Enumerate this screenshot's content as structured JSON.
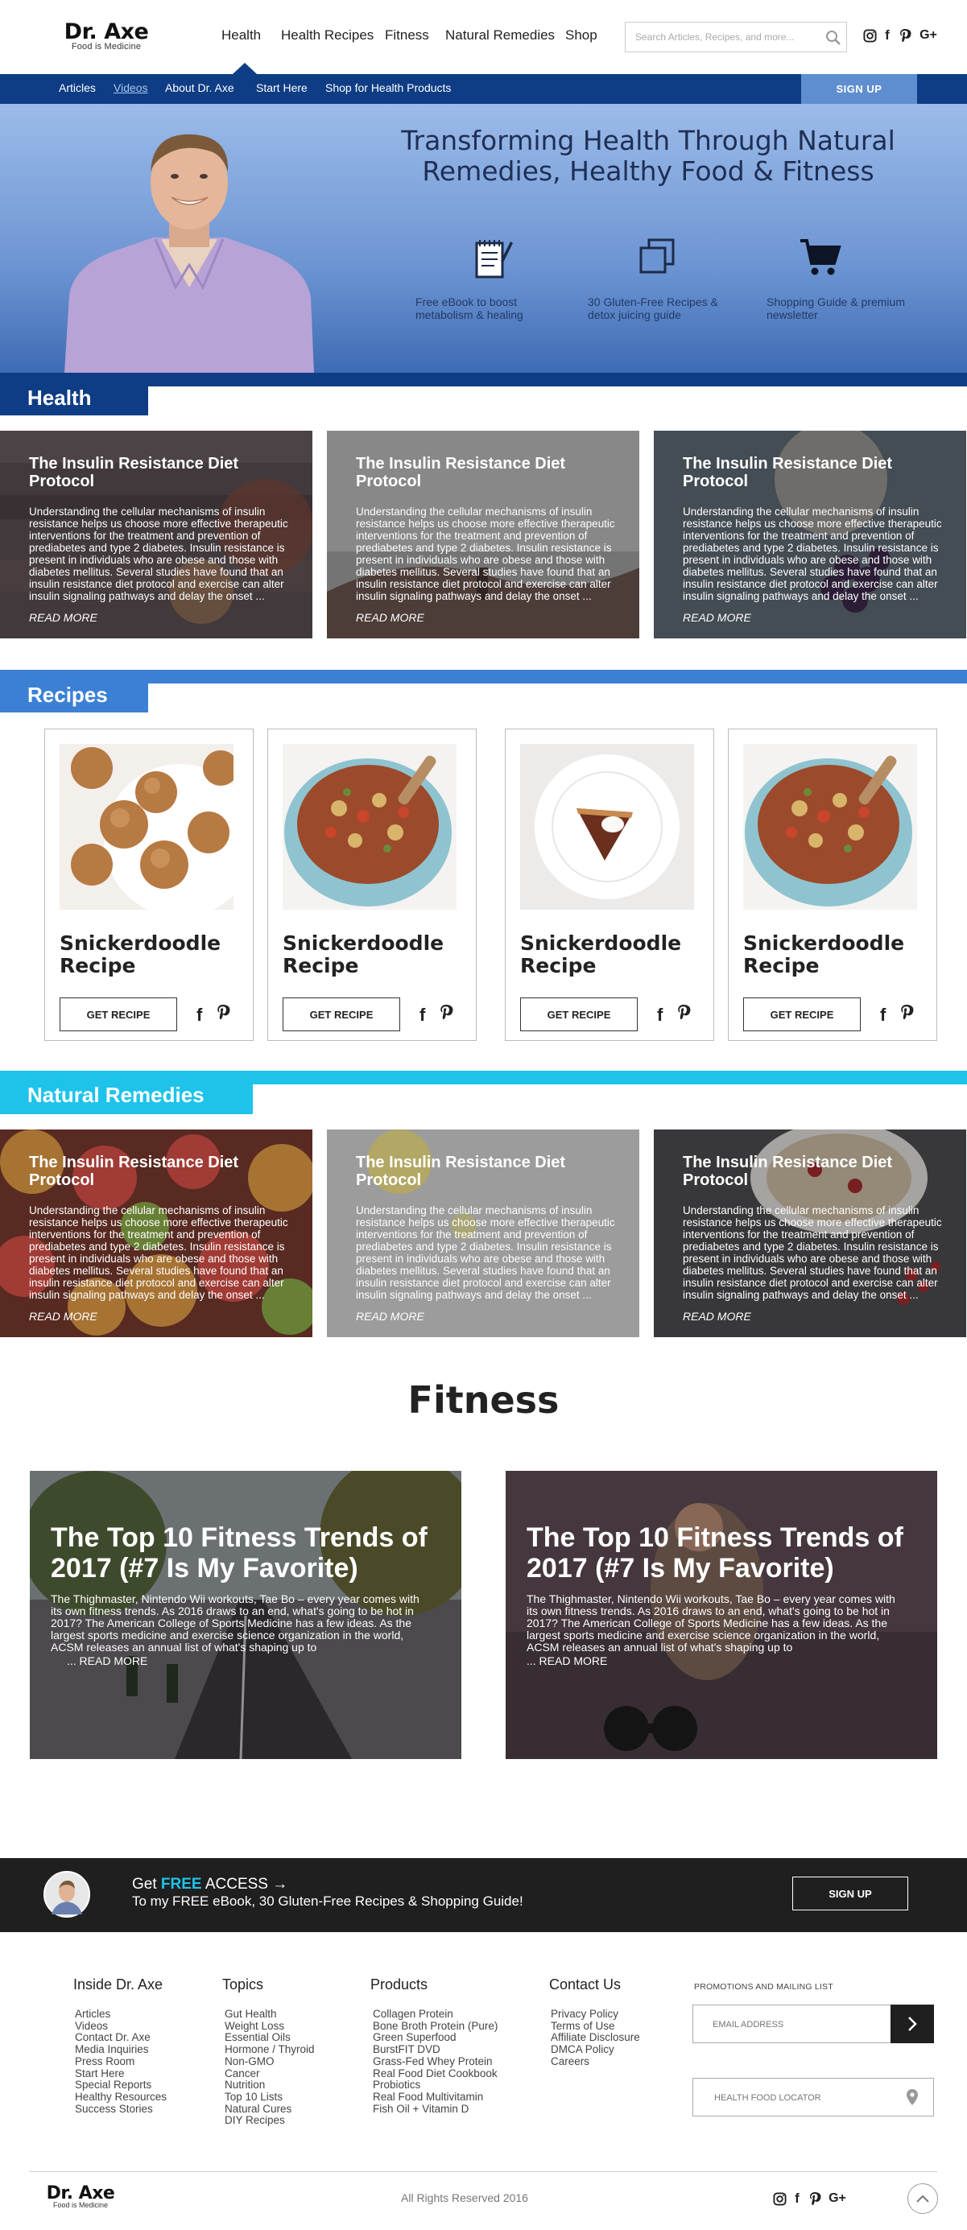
{
  "header": {
    "logo_name": "Dr. Axe",
    "logo_tagline": "Food is Medicine",
    "nav": [
      "Health",
      "Health Recipes",
      "Fitness",
      "Natural Remedies",
      "Shop"
    ],
    "search_placeholder": "Search Articles, Recipes, and more...",
    "social": [
      "instagram-icon",
      "facebook-icon",
      "pinterest-icon",
      "google-plus-icon"
    ],
    "google_plus_label": "G+",
    "facebook_label": "f"
  },
  "subnav": {
    "items": [
      "Articles",
      "Videos",
      "About Dr. Axe",
      "Start Here",
      "Shop for Health Products"
    ],
    "active": "Videos",
    "signup_label": "SIGN UP"
  },
  "hero": {
    "title": "Transforming Health Through Natural Remedies, Healthy Food & Fitness",
    "features": [
      {
        "icon": "notepad-icon",
        "label": "Free eBook to boost metabolism & healing"
      },
      {
        "icon": "copy-icon",
        "label": "30 Gluten-Free Recipes & detox juicing guide"
      },
      {
        "icon": "cart-icon",
        "label": "Shopping Guide & premium newsletter"
      }
    ]
  },
  "sections": {
    "health": "Health",
    "recipes": "Recipes",
    "natural_remedies": "Natural Remedies",
    "fitness": "Fitness"
  },
  "article": {
    "title": "The Insulin Resistance Diet Protocol",
    "excerpt": "Understanding the cellular mechanisms of insulin resistance helps us choose more effective therapeutic interventions for the treatment and prevention of prediabetes and type 2 diabetes. Insulin resistance is present in individuals who are obese and those with diabetes mellitus. Several studies have found that an insulin resistance diet protocol and exercise can alter insulin signaling pathways and delay the onset ...",
    "read_more": "READ MORE"
  },
  "recipes": {
    "items": [
      {
        "name": "Snickerdoodle Recipe",
        "image": "cookies"
      },
      {
        "name": "Snickerdoodle Recipe",
        "image": "soup"
      },
      {
        "name": "Snickerdoodle Recipe",
        "image": "pie"
      },
      {
        "name": "Snickerdoodle Recipe",
        "image": "soup"
      }
    ],
    "button_label": "GET RECIPE"
  },
  "fitness": {
    "title": "The Top 10 Fitness Trends of 2017 (#7 Is My Favorite)",
    "excerpt": "The Thighmaster, Nintendo Wii workouts, Tae Bo – every year comes with its own fitness trends. As 2016 draws to an end, what's going to be hot in 2017? The American College of Sports Medicine has a few ideas. As the largest sports medicine and exercise science organization in the world, ACSM releases an annual list of what's shaping up to",
    "read_more": "... READ MORE"
  },
  "cta": {
    "line1_prefix": "Get ",
    "line1_free": "FREE",
    "line1_suffix": " ACCESS →",
    "line2": "To my FREE eBook, 30 Gluten-Free Recipes & Shopping Guide!",
    "button_label": "SIGN UP"
  },
  "footer": {
    "columns": [
      {
        "heading": "Inside Dr. Axe",
        "links": [
          "Articles",
          "Videos",
          "Contact Dr. Axe",
          "Media Inquiries",
          "Press Room",
          "Start Here",
          "Special Reports",
          "Healthy Resources",
          "Success Stories"
        ]
      },
      {
        "heading": "Topics",
        "links": [
          "Gut Health",
          "Weight Loss",
          "Essential Oils",
          "Hormone / Thyroid",
          "Non-GMO",
          "Cancer",
          "Nutrition",
          "Top 10 Lists",
          "Natural Cures",
          "DIY Recipes"
        ]
      },
      {
        "heading": "Products",
        "links": [
          "Collagen Protein",
          "Bone Broth Protein (Pure)",
          "Green Superfood",
          "BurstFIT DVD",
          "Grass-Fed Whey Protein",
          "Real Food Diet Cookbook",
          "Probiotics",
          "Real Food Multivitamin",
          "Fish Oil + Vitamin D"
        ]
      },
      {
        "heading": "Contact Us",
        "links": [
          "Privacy Policy",
          "Terms of Use",
          "Affiliate Disclosure",
          "DMCA Policy",
          "Careers"
        ]
      }
    ],
    "promo_label": "PROMOTIONS AND MAILING LIST",
    "email_placeholder": "EMAIL ADDRESS",
    "locator_placeholder": "HEALTH FOOD LOCATOR",
    "copyright": "All Rights Reserved 2016",
    "logo_name": "Dr. Axe",
    "logo_tagline": "Food is Medicine"
  },
  "colors": {
    "navy": "#0f3d85",
    "recipes_blue": "#3b80d4",
    "remedies_cyan": "#1ec3ea",
    "dark": "#1f1f1f"
  }
}
